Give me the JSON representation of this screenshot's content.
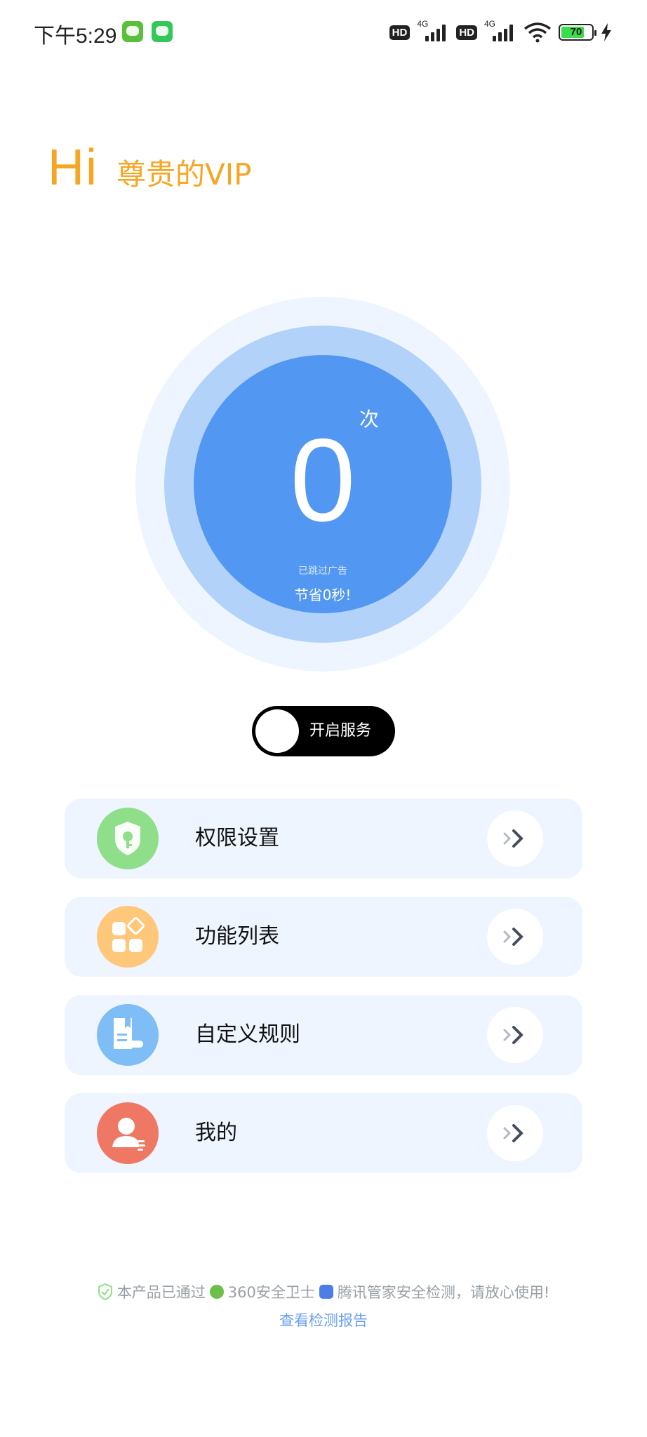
{
  "status_bar": {
    "time": "下午5:29",
    "network_1": "4G",
    "network_2": "4G",
    "hd_label": "HD",
    "battery_level": "70",
    "icons": [
      "wechat-icon",
      "app-icon",
      "hd-icon",
      "signal-icon",
      "wifi-icon",
      "battery-icon",
      "charging-icon"
    ]
  },
  "greeting": {
    "hi": "Hi",
    "title": "尊贵的VIP"
  },
  "counter": {
    "value": "0",
    "unit": "次",
    "description": "已跳过广告",
    "saved": "节省0秒!"
  },
  "service_toggle": {
    "label": "开启服务",
    "on": false
  },
  "menu": [
    {
      "label": "权限设置",
      "icon": "shield-key-icon",
      "color": "#8ede8a"
    },
    {
      "label": "功能列表",
      "icon": "grid-icon",
      "color": "#ffc77a"
    },
    {
      "label": "自定义规则",
      "icon": "document-hand-icon",
      "color": "#7ebdf5"
    },
    {
      "label": "我的",
      "icon": "user-icon",
      "color": "#ee7864"
    }
  ],
  "footer": {
    "pass_text": "本产品已通过",
    "brand_360": "360安全卫士",
    "tencent_text": "腾讯管家安全检测，请放心使用!",
    "report_link": "查看检测报告"
  },
  "colors": {
    "accent_orange": "#f5a623",
    "circle_core": "#5297f2",
    "circle_mid": "#b2d2fa",
    "circle_outer": "#eef5fe",
    "card_bg": "#eef5fe",
    "link": "#6a9ff0"
  }
}
